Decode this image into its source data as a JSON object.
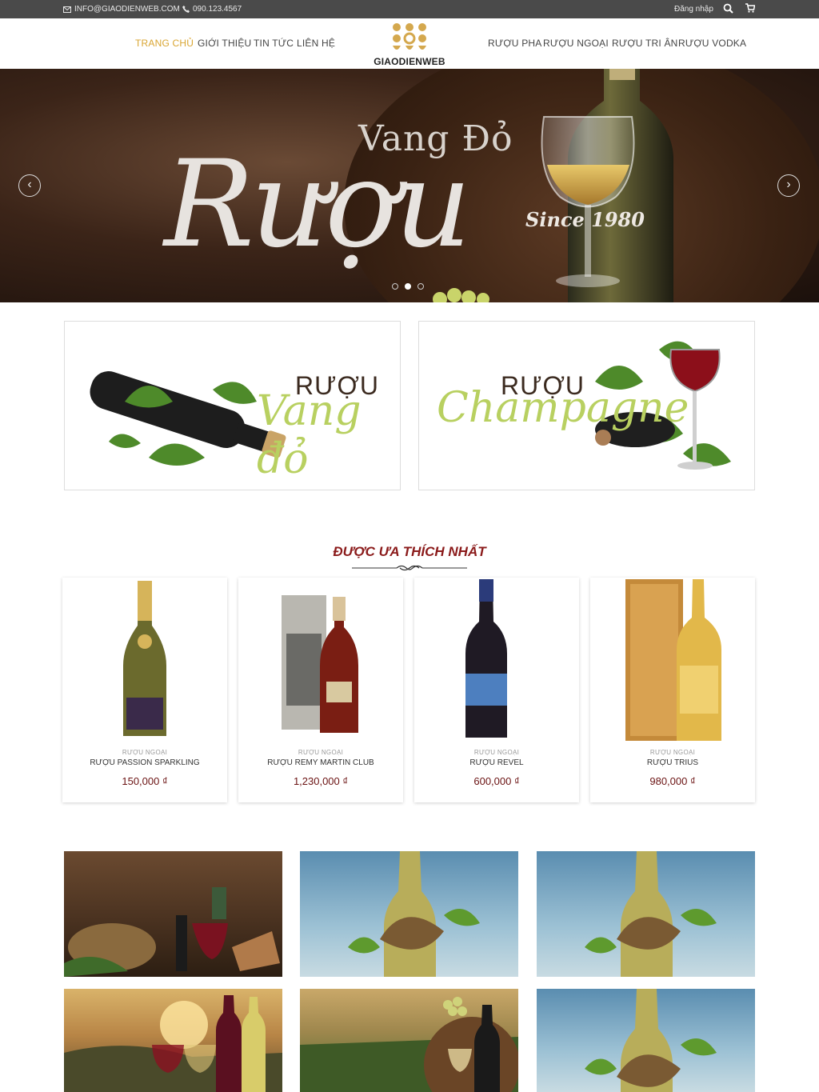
{
  "topbar": {
    "email": "INFO@GIAODIENWEB.COM",
    "phone": "090.123.4567",
    "login": "Đăng nhập"
  },
  "nav": {
    "left": [
      "TRANG CHỦ",
      "GIỚI THIỆU",
      "TIN TỨC",
      "LIÊN HỆ"
    ],
    "right": [
      "RƯỢU PHA",
      "RƯỢU NGOẠI",
      "RƯỢU TRI ÂN",
      "RƯỢU VODKA"
    ]
  },
  "logo": {
    "text": "GIAODIENWEB"
  },
  "hero": {
    "script": "Rượu",
    "sub": "Vang Đỏ",
    "since": "Since 1980"
  },
  "banners": [
    {
      "title": "RƯỢU",
      "script": "Vang đỏ"
    },
    {
      "title": "RƯỢU",
      "script": "Champagne"
    }
  ],
  "section": {
    "title": "ĐƯỢC ƯA THÍCH NHẤT"
  },
  "products": [
    {
      "category": "RƯỢU NGOẠI",
      "name": "RƯỢU PASSION SPARKLING",
      "price": "150,000 ₫"
    },
    {
      "category": "RƯỢU NGOẠI",
      "name": "RƯỢU REMY MARTIN CLUB",
      "price": "1,230,000 ₫"
    },
    {
      "category": "RƯỢU NGOẠI",
      "name": "RƯỢU REVEL",
      "price": "600,000 ₫"
    },
    {
      "category": "RƯỢU NGOẠI",
      "name": "RƯỢU TRIUS",
      "price": "980,000 ₫"
    }
  ],
  "colors": {
    "accent": "#d9a531",
    "price": "#6b1313",
    "topbar": "#4a4a4a",
    "banner_script": "#b8d060"
  }
}
